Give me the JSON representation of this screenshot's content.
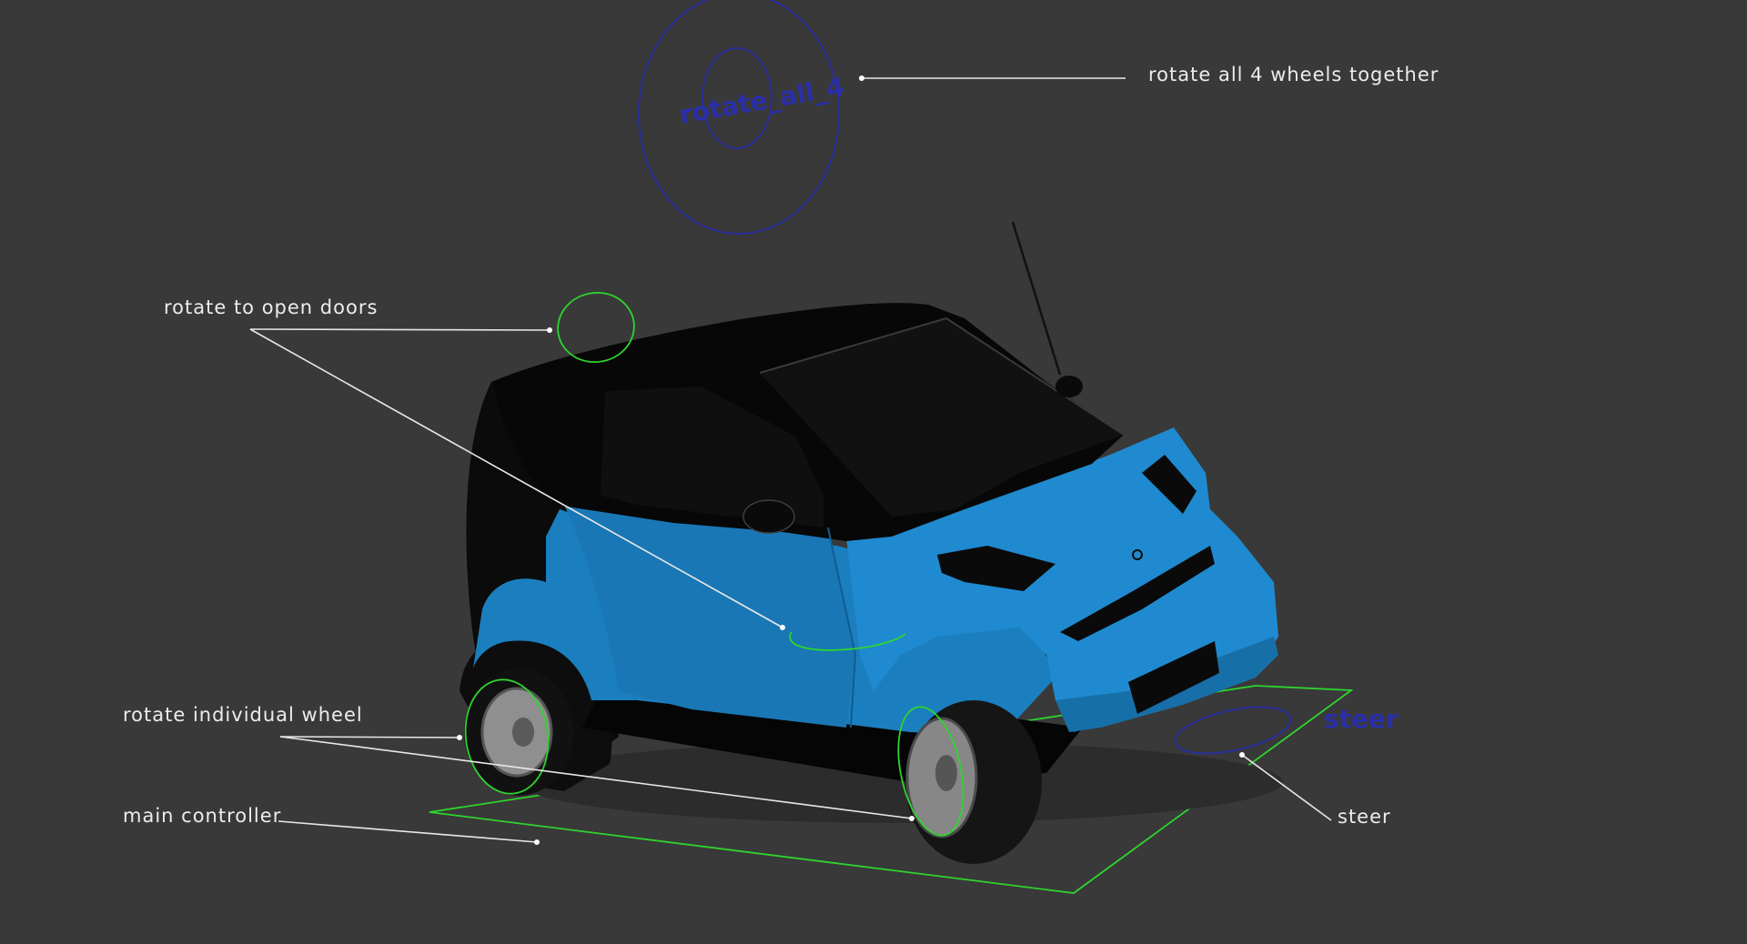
{
  "viewport": {
    "background": "#393939",
    "car_body_color": "#1f86c8",
    "car_roof_color": "#080808",
    "controller_color_green": "#2ed42e",
    "controller_color_blue": "#2a2f9a"
  },
  "annotations": {
    "rotate_all": "rotate all 4 wheels together",
    "open_doors": "rotate to open doors",
    "individual_wheel": "rotate individual wheel",
    "main_controller": "main controller",
    "steer": "steer"
  },
  "controllers": {
    "rotate_all_label": "rotate_all_4",
    "steer_label": "steer"
  }
}
